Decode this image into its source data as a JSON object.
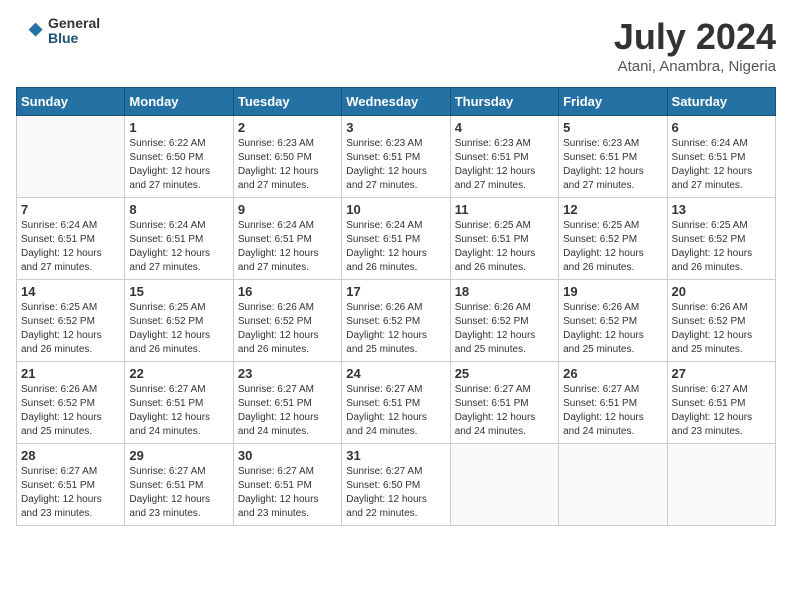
{
  "header": {
    "logo_general": "General",
    "logo_blue": "Blue",
    "title": "July 2024",
    "subtitle": "Atani, Anambra, Nigeria"
  },
  "days_of_week": [
    "Sunday",
    "Monday",
    "Tuesday",
    "Wednesday",
    "Thursday",
    "Friday",
    "Saturday"
  ],
  "weeks": [
    [
      {
        "day": "",
        "detail": ""
      },
      {
        "day": "1",
        "detail": "Sunrise: 6:22 AM\nSunset: 6:50 PM\nDaylight: 12 hours\nand 27 minutes."
      },
      {
        "day": "2",
        "detail": "Sunrise: 6:23 AM\nSunset: 6:50 PM\nDaylight: 12 hours\nand 27 minutes."
      },
      {
        "day": "3",
        "detail": "Sunrise: 6:23 AM\nSunset: 6:51 PM\nDaylight: 12 hours\nand 27 minutes."
      },
      {
        "day": "4",
        "detail": "Sunrise: 6:23 AM\nSunset: 6:51 PM\nDaylight: 12 hours\nand 27 minutes."
      },
      {
        "day": "5",
        "detail": "Sunrise: 6:23 AM\nSunset: 6:51 PM\nDaylight: 12 hours\nand 27 minutes."
      },
      {
        "day": "6",
        "detail": "Sunrise: 6:24 AM\nSunset: 6:51 PM\nDaylight: 12 hours\nand 27 minutes."
      }
    ],
    [
      {
        "day": "7",
        "detail": "Sunrise: 6:24 AM\nSunset: 6:51 PM\nDaylight: 12 hours\nand 27 minutes."
      },
      {
        "day": "8",
        "detail": "Sunrise: 6:24 AM\nSunset: 6:51 PM\nDaylight: 12 hours\nand 27 minutes."
      },
      {
        "day": "9",
        "detail": "Sunrise: 6:24 AM\nSunset: 6:51 PM\nDaylight: 12 hours\nand 27 minutes."
      },
      {
        "day": "10",
        "detail": "Sunrise: 6:24 AM\nSunset: 6:51 PM\nDaylight: 12 hours\nand 26 minutes."
      },
      {
        "day": "11",
        "detail": "Sunrise: 6:25 AM\nSunset: 6:51 PM\nDaylight: 12 hours\nand 26 minutes."
      },
      {
        "day": "12",
        "detail": "Sunrise: 6:25 AM\nSunset: 6:52 PM\nDaylight: 12 hours\nand 26 minutes."
      },
      {
        "day": "13",
        "detail": "Sunrise: 6:25 AM\nSunset: 6:52 PM\nDaylight: 12 hours\nand 26 minutes."
      }
    ],
    [
      {
        "day": "14",
        "detail": "Sunrise: 6:25 AM\nSunset: 6:52 PM\nDaylight: 12 hours\nand 26 minutes."
      },
      {
        "day": "15",
        "detail": "Sunrise: 6:25 AM\nSunset: 6:52 PM\nDaylight: 12 hours\nand 26 minutes."
      },
      {
        "day": "16",
        "detail": "Sunrise: 6:26 AM\nSunset: 6:52 PM\nDaylight: 12 hours\nand 26 minutes."
      },
      {
        "day": "17",
        "detail": "Sunrise: 6:26 AM\nSunset: 6:52 PM\nDaylight: 12 hours\nand 25 minutes."
      },
      {
        "day": "18",
        "detail": "Sunrise: 6:26 AM\nSunset: 6:52 PM\nDaylight: 12 hours\nand 25 minutes."
      },
      {
        "day": "19",
        "detail": "Sunrise: 6:26 AM\nSunset: 6:52 PM\nDaylight: 12 hours\nand 25 minutes."
      },
      {
        "day": "20",
        "detail": "Sunrise: 6:26 AM\nSunset: 6:52 PM\nDaylight: 12 hours\nand 25 minutes."
      }
    ],
    [
      {
        "day": "21",
        "detail": "Sunrise: 6:26 AM\nSunset: 6:52 PM\nDaylight: 12 hours\nand 25 minutes."
      },
      {
        "day": "22",
        "detail": "Sunrise: 6:27 AM\nSunset: 6:51 PM\nDaylight: 12 hours\nand 24 minutes."
      },
      {
        "day": "23",
        "detail": "Sunrise: 6:27 AM\nSunset: 6:51 PM\nDaylight: 12 hours\nand 24 minutes."
      },
      {
        "day": "24",
        "detail": "Sunrise: 6:27 AM\nSunset: 6:51 PM\nDaylight: 12 hours\nand 24 minutes."
      },
      {
        "day": "25",
        "detail": "Sunrise: 6:27 AM\nSunset: 6:51 PM\nDaylight: 12 hours\nand 24 minutes."
      },
      {
        "day": "26",
        "detail": "Sunrise: 6:27 AM\nSunset: 6:51 PM\nDaylight: 12 hours\nand 24 minutes."
      },
      {
        "day": "27",
        "detail": "Sunrise: 6:27 AM\nSunset: 6:51 PM\nDaylight: 12 hours\nand 23 minutes."
      }
    ],
    [
      {
        "day": "28",
        "detail": "Sunrise: 6:27 AM\nSunset: 6:51 PM\nDaylight: 12 hours\nand 23 minutes."
      },
      {
        "day": "29",
        "detail": "Sunrise: 6:27 AM\nSunset: 6:51 PM\nDaylight: 12 hours\nand 23 minutes."
      },
      {
        "day": "30",
        "detail": "Sunrise: 6:27 AM\nSunset: 6:51 PM\nDaylight: 12 hours\nand 23 minutes."
      },
      {
        "day": "31",
        "detail": "Sunrise: 6:27 AM\nSunset: 6:50 PM\nDaylight: 12 hours\nand 22 minutes."
      },
      {
        "day": "",
        "detail": ""
      },
      {
        "day": "",
        "detail": ""
      },
      {
        "day": "",
        "detail": ""
      }
    ]
  ]
}
